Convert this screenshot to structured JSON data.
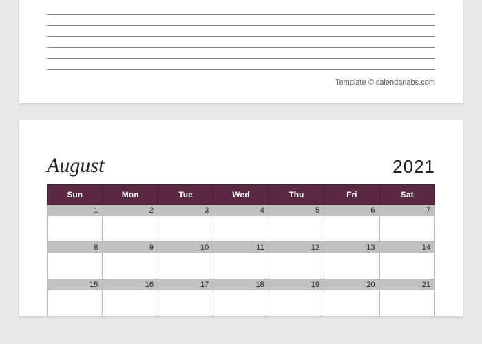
{
  "credit": "Template © calendarlabs.com",
  "calendar": {
    "month": "August",
    "year": "2021",
    "days": [
      "Sun",
      "Mon",
      "Tue",
      "Wed",
      "Thu",
      "Fri",
      "Sat"
    ],
    "weeks": [
      [
        "1",
        "2",
        "3",
        "4",
        "5",
        "6",
        "7"
      ],
      [
        "8",
        "9",
        "10",
        "11",
        "12",
        "13",
        "14"
      ],
      [
        "15",
        "16",
        "17",
        "18",
        "19",
        "20",
        "21"
      ]
    ]
  }
}
